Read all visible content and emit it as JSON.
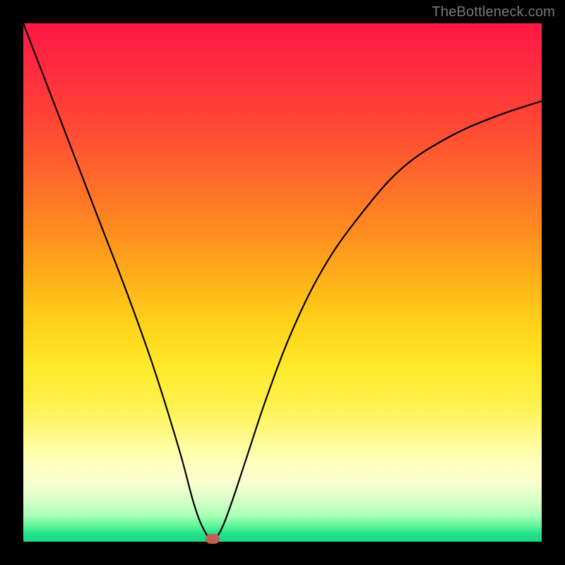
{
  "watermark": "TheBottleneck.com",
  "colors": {
    "frame": "#000000",
    "curve": "#000000",
    "marker": "#c06055",
    "gradient_top": "#ff1744",
    "gradient_bottom": "#1ad885"
  },
  "chart_data": {
    "type": "line",
    "title": "",
    "xlabel": "",
    "ylabel": "",
    "xlim": [
      0,
      100
    ],
    "ylim": [
      0,
      100
    ],
    "legend": false,
    "grid": false,
    "series": [
      {
        "name": "bottleneck-curve",
        "x": [
          0,
          5,
          10,
          15,
          20,
          25,
          30,
          33,
          35,
          36.5,
          38,
          40,
          43,
          47,
          52,
          58,
          65,
          73,
          82,
          91,
          100
        ],
        "y": [
          100,
          87,
          74,
          61,
          48,
          34,
          18,
          7,
          2,
          0.5,
          2,
          7,
          16,
          28,
          41,
          53,
          63,
          72,
          78,
          82,
          85
        ]
      }
    ],
    "marker": {
      "x": 36.5,
      "y": 0.5
    },
    "annotations": []
  }
}
